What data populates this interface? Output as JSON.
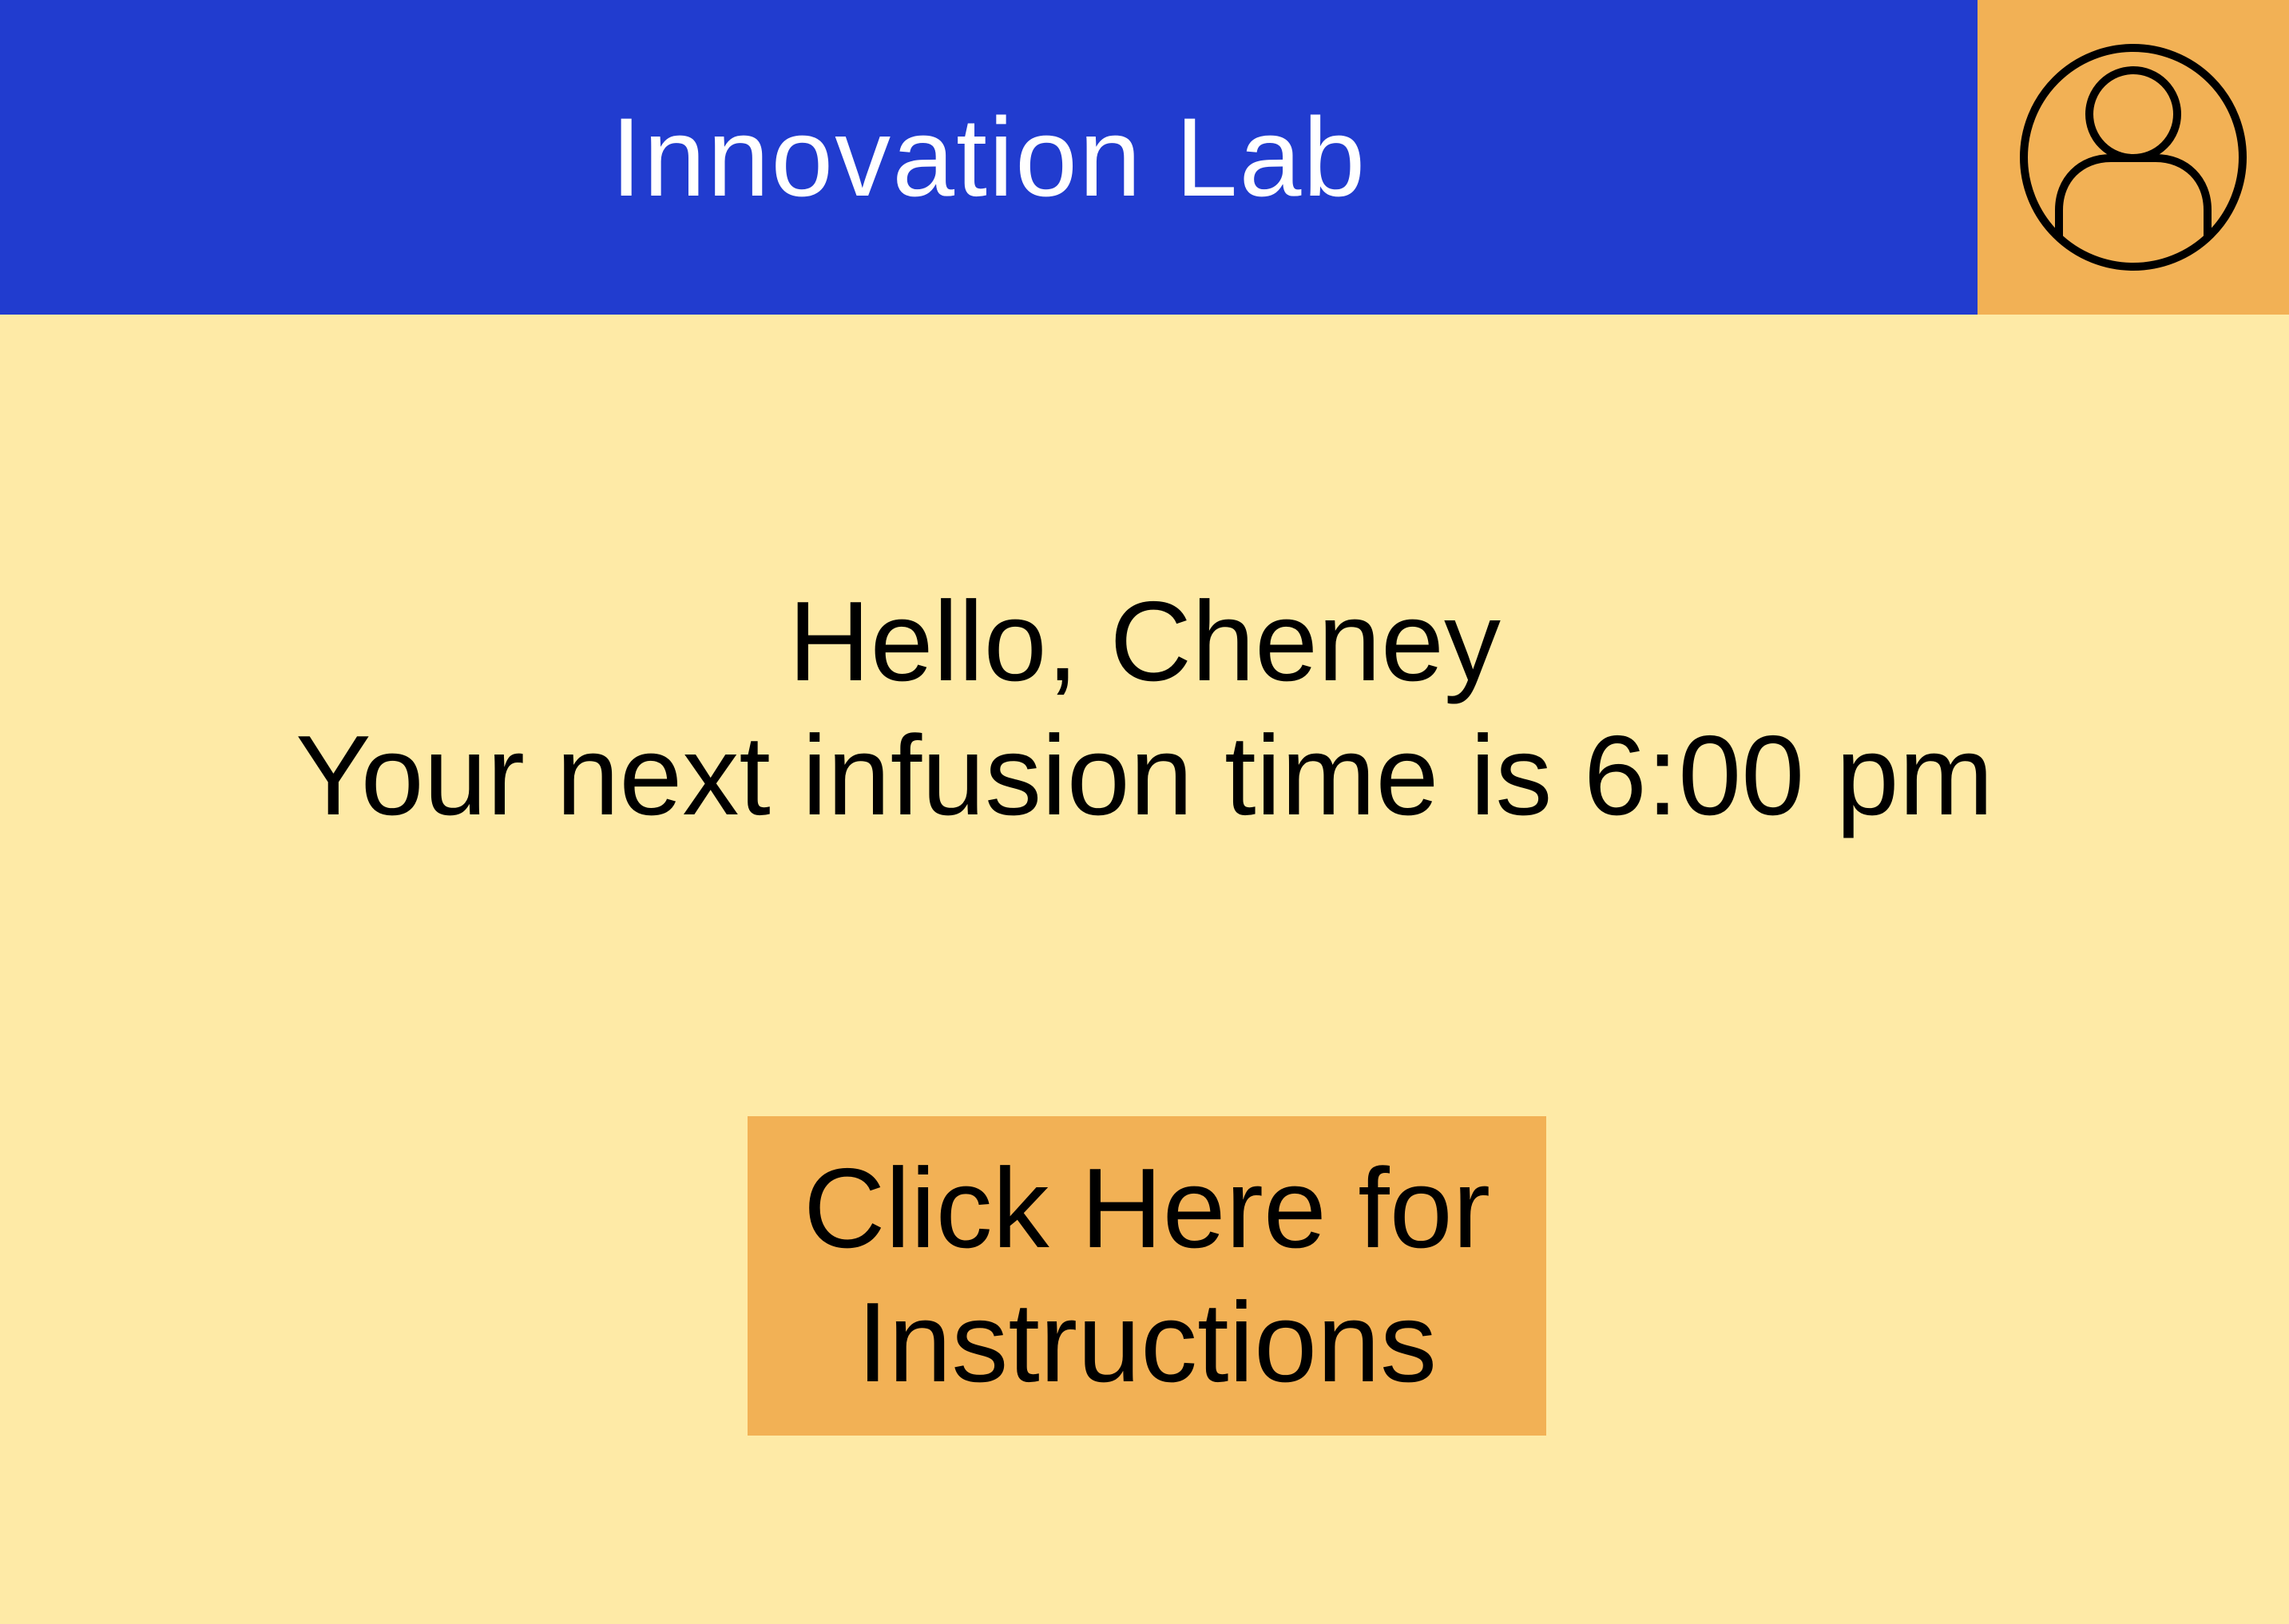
{
  "header": {
    "title": "Innovation Lab",
    "profile_icon": "user-circle-icon"
  },
  "greeting": {
    "line1": "Hello, Cheney",
    "line2": "Your next infusion time is 6:00 pm"
  },
  "button": {
    "line1": "Click Here for",
    "line2": "Instructions"
  },
  "colors": {
    "header_background": "#213CCF",
    "accent": "#F2B155",
    "page_background": "#FEEAA6",
    "text": "#000000",
    "header_text": "#FFFFFF"
  }
}
